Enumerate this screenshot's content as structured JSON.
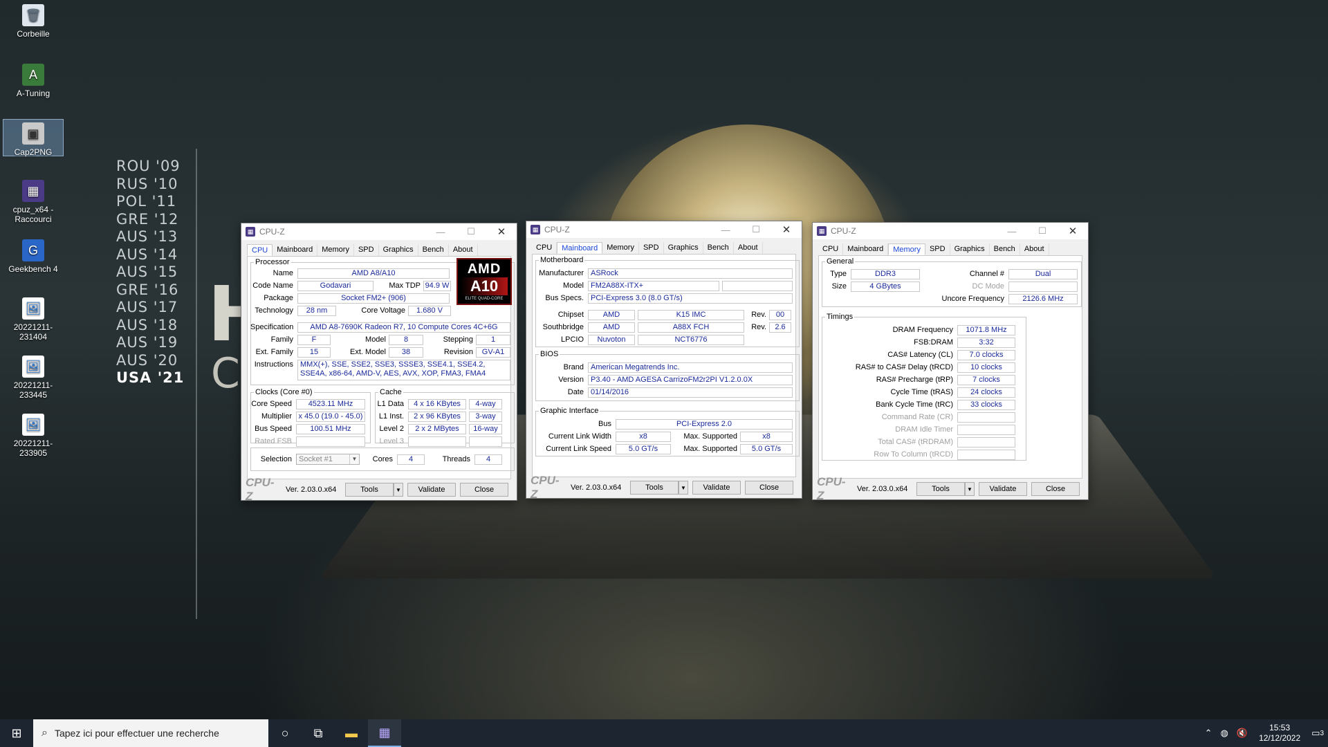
{
  "desktop": {
    "icons": [
      {
        "label": "Corbeille",
        "icon": "recycle-bin-icon"
      },
      {
        "label": "A-Tuning",
        "icon": "a-tuning-icon"
      },
      {
        "label": "Cap2PNG",
        "icon": "cap2png-icon"
      },
      {
        "label": "cpuz_x64 - Raccourci",
        "icon": "cpuz-icon"
      },
      {
        "label": "Geekbench 4",
        "icon": "geekbench-icon"
      },
      {
        "label": "20221211-231404",
        "icon": "image-file-icon"
      },
      {
        "label": "20221211-233445",
        "icon": "image-file-icon"
      },
      {
        "label": "20221211-233905",
        "icon": "image-file-icon"
      }
    ],
    "wallpaper_years": [
      "ROU '09",
      "RUS '10",
      "POL '11",
      "GRE '12",
      "AUS '13",
      "AUS '14",
      "AUS '15",
      "GRE '16",
      "AUS '17",
      "AUS '18",
      "AUS '19",
      "AUS '20",
      "USA '21"
    ],
    "wallpaper_letters": [
      "H",
      "C"
    ]
  },
  "common": {
    "app_title": "CPU-Z",
    "tabs": [
      "CPU",
      "Mainboard",
      "Memory",
      "SPD",
      "Graphics",
      "Bench",
      "About"
    ],
    "brand": "CPU-Z",
    "version": "Ver. 2.03.0.x64",
    "tools_label": "Tools",
    "validate_label": "Validate",
    "close_label": "Close",
    "min_glyph": "—",
    "max_glyph": "☐",
    "close_glyph": "✕",
    "drop_glyph": "▼"
  },
  "cpu_win": {
    "processor_legend": "Processor",
    "name_label": "Name",
    "name": "AMD A8/A10",
    "codename_label": "Code Name",
    "codename": "Godavari",
    "maxtdp_label": "Max TDP",
    "maxtdp": "94.9 W",
    "package_label": "Package",
    "package": "Socket FM2+ (906)",
    "technology_label": "Technology",
    "technology": "28 nm",
    "corevoltage_label": "Core Voltage",
    "corevoltage": "1.680 V",
    "spec_label": "Specification",
    "spec": "AMD A8-7690K Radeon R7, 10 Compute Cores 4C+6G",
    "family_label": "Family",
    "family": "F",
    "model_label": "Model",
    "model": "8",
    "stepping_label": "Stepping",
    "stepping": "1",
    "extfamily_label": "Ext. Family",
    "extfamily": "15",
    "extmodel_label": "Ext. Model",
    "extmodel": "38",
    "revision_label": "Revision",
    "revision": "GV-A1",
    "instructions_label": "Instructions",
    "instructions": "MMX(+), SSE, SSE2, SSE3, SSSE3, SSE4.1, SSE4.2, SSE4A, x86-64, AMD-V, AES, AVX, XOP, FMA3, FMA4",
    "logo_brand": "AMD",
    "logo_model": "A10",
    "logo_tag": "ELITE QUAD-CORE",
    "clocks_legend": "Clocks (Core #0)",
    "corespeed_label": "Core Speed",
    "corespeed": "4523.11 MHz",
    "multiplier_label": "Multiplier",
    "multiplier": "x 45.0 (19.0 - 45.0)",
    "busspeed_label": "Bus Speed",
    "busspeed": "100.51 MHz",
    "ratedfsb_label": "Rated FSB",
    "ratedfsb": "",
    "cache_legend": "Cache",
    "l1data_label": "L1 Data",
    "l1data": "4 x 16 KBytes",
    "l1data_way": "4-way",
    "l1inst_label": "L1 Inst.",
    "l1inst": "2 x 96 KBytes",
    "l1inst_way": "3-way",
    "level2_label": "Level 2",
    "level2": "2 x 2 MBytes",
    "level2_way": "16-way",
    "level3_label": "Level 3",
    "level3": "",
    "level3_way": "",
    "selection_label": "Selection",
    "selection": "Socket #1",
    "cores_label": "Cores",
    "cores": "4",
    "threads_label": "Threads",
    "threads": "4"
  },
  "mb_win": {
    "mb_legend": "Motherboard",
    "manufacturer_label": "Manufacturer",
    "manufacturer": "ASRock",
    "model_label": "Model",
    "model": "FM2A88X-ITX+",
    "model_extra": "",
    "busspecs_label": "Bus Specs.",
    "busspecs": "PCI-Express 3.0 (8.0 GT/s)",
    "chipset_label": "Chipset",
    "chipset_vendor": "AMD",
    "chipset": "K15 IMC",
    "chipset_rev_label": "Rev.",
    "chipset_rev": "00",
    "south_label": "Southbridge",
    "south_vendor": "AMD",
    "south": "A88X FCH",
    "south_rev_label": "Rev.",
    "south_rev": "2.6",
    "lpcio_label": "LPCIO",
    "lpcio_vendor": "Nuvoton",
    "lpcio": "NCT6776",
    "bios_legend": "BIOS",
    "brand_label": "Brand",
    "brand": "American Megatrends Inc.",
    "version_label": "Version",
    "version": "P3.40 - AMD AGESA CarrizoFM2r2PI V1.2.0.0X",
    "date_label": "Date",
    "date": "01/14/2016",
    "gi_legend": "Graphic Interface",
    "bus_label": "Bus",
    "bus": "PCI-Express 2.0",
    "clw_label": "Current Link Width",
    "clw": "x8",
    "maxsup1_label": "Max. Supported",
    "maxsup1": "x8",
    "cls_label": "Current Link Speed",
    "cls": "5.0 GT/s",
    "maxsup2_label": "Max. Supported",
    "maxsup2": "5.0 GT/s"
  },
  "mem_win": {
    "general_legend": "General",
    "type_label": "Type",
    "type": "DDR3",
    "channel_label": "Channel #",
    "channel": "Dual",
    "size_label": "Size",
    "size": "4 GBytes",
    "dcmode_label": "DC Mode",
    "dcmode": "",
    "uncore_label": "Uncore Frequency",
    "uncore": "2126.6 MHz",
    "timings_legend": "Timings",
    "timings": [
      {
        "label": "DRAM Frequency",
        "value": "1071.8 MHz",
        "gray": false
      },
      {
        "label": "FSB:DRAM",
        "value": "3:32",
        "gray": false
      },
      {
        "label": "CAS# Latency (CL)",
        "value": "7.0 clocks",
        "gray": false
      },
      {
        "label": "RAS# to CAS# Delay (tRCD)",
        "value": "10 clocks",
        "gray": false
      },
      {
        "label": "RAS# Precharge (tRP)",
        "value": "7 clocks",
        "gray": false
      },
      {
        "label": "Cycle Time (tRAS)",
        "value": "24 clocks",
        "gray": false
      },
      {
        "label": "Bank Cycle Time (tRC)",
        "value": "33 clocks",
        "gray": false
      },
      {
        "label": "Command Rate (CR)",
        "value": "",
        "gray": true
      },
      {
        "label": "DRAM Idle Timer",
        "value": "",
        "gray": true
      },
      {
        "label": "Total CAS# (tRDRAM)",
        "value": "",
        "gray": true
      },
      {
        "label": "Row To Column (tRCD)",
        "value": "",
        "gray": true
      }
    ]
  },
  "taskbar": {
    "search_placeholder": "Tapez ici pour effectuer une recherche",
    "time": "15:53",
    "date": "12/12/2022",
    "notifications": "3"
  }
}
